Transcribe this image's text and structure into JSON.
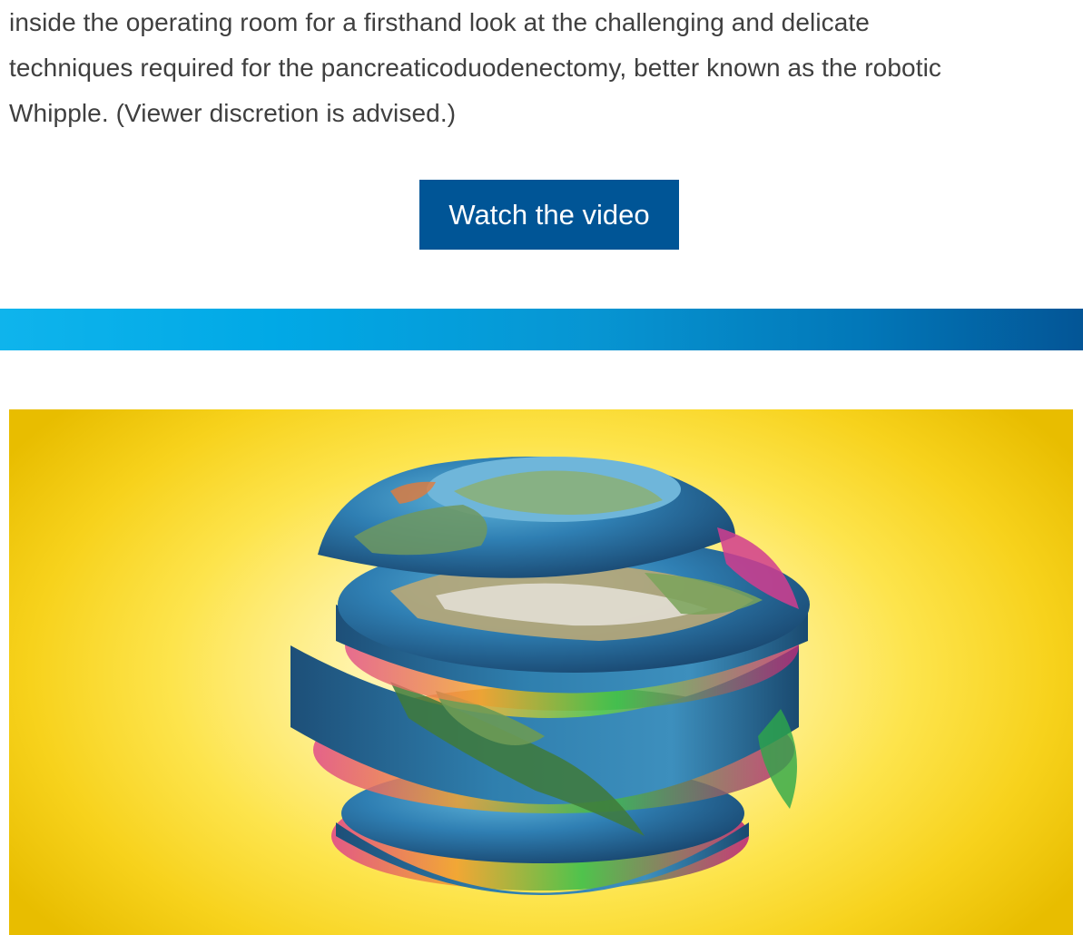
{
  "article": {
    "intro_line1": "inside the operating room for a firsthand look at the challenging and delicate",
    "intro_line2": "techniques required for the pancreaticoduodenectomy, better known as the robotic",
    "intro_line3": "Whipple. (Viewer discretion is advised.)"
  },
  "cta": {
    "label": "Watch the video",
    "color": "#005596"
  },
  "divider": {
    "colors": [
      "#0fb4ec",
      "#035596"
    ]
  },
  "hero": {
    "subject": "sliced-earth-globe-illustration",
    "background_color": "#f7d21c"
  }
}
